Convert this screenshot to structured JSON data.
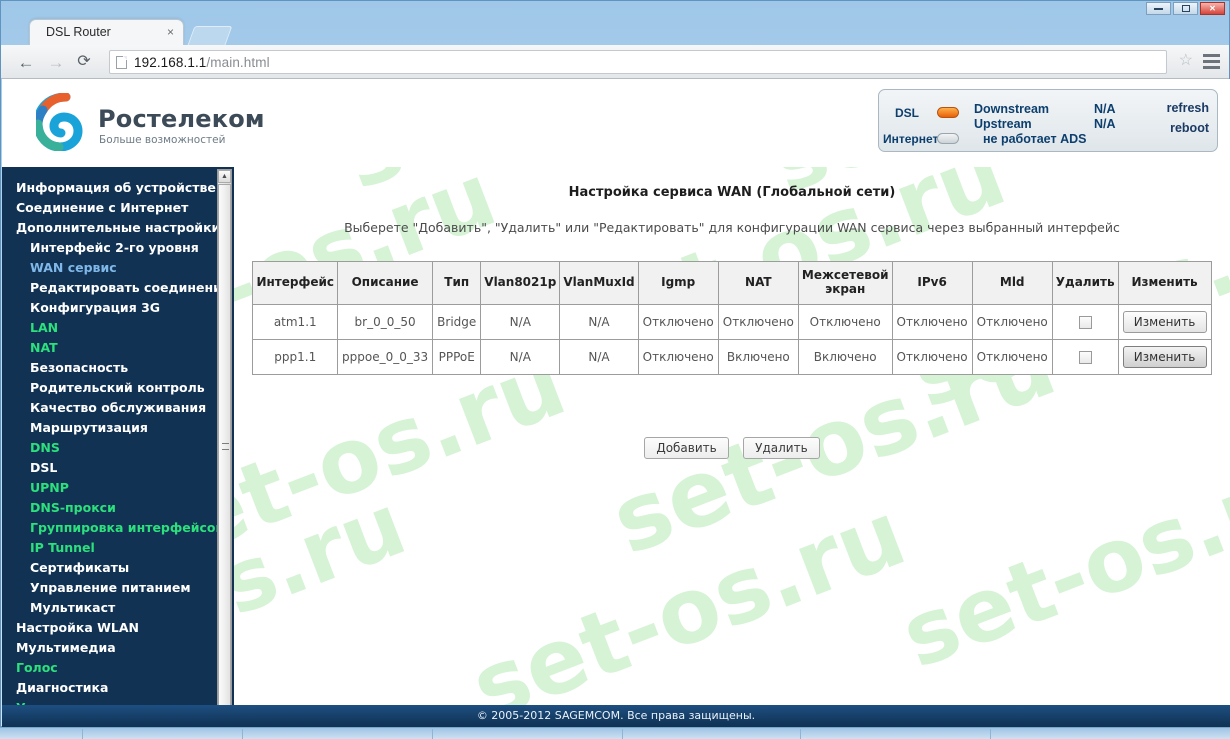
{
  "browser": {
    "tab_title": "DSL Router",
    "tab_close": "×",
    "back_icon": "←",
    "forward_icon": "→",
    "reload_icon": "⟳",
    "url_host": "192.168.1.1",
    "url_path": "/main.html",
    "star_icon": "☆",
    "window_close": "✕"
  },
  "header": {
    "brand_name": "Ростелеком",
    "brand_tagline": "Больше возможностей",
    "status": {
      "dsl_label": "DSL",
      "internet_label": "Интернет",
      "downstream_label": "Downstream",
      "downstream_value": "N/A",
      "upstream_label": "Upstream",
      "upstream_value": "N/A",
      "internet_message": "не работает ADS",
      "refresh_label": "refresh",
      "reboot_label": "reboot",
      "dsl_led_color": "#e8600c",
      "internet_led_color": "#ccd3d7"
    }
  },
  "sidebar": {
    "items": [
      {
        "label": "Информация об устройстве",
        "level": 1,
        "state": "normal"
      },
      {
        "label": "Соединение с Интернет",
        "level": 1,
        "state": "normal"
      },
      {
        "label": "Дополнительные настройки",
        "level": 1,
        "state": "normal"
      },
      {
        "label": "Интерфейс 2-го уровня",
        "level": 2,
        "state": "normal"
      },
      {
        "label": "WAN сервис",
        "level": 2,
        "state": "selected"
      },
      {
        "label": "Редактировать соединения",
        "level": 2,
        "state": "normal"
      },
      {
        "label": "Конфигурация 3G",
        "level": 2,
        "state": "normal"
      },
      {
        "label": "LAN",
        "level": 2,
        "state": "accent"
      },
      {
        "label": "NAT",
        "level": 2,
        "state": "accent"
      },
      {
        "label": "Безопасность",
        "level": 2,
        "state": "normal"
      },
      {
        "label": "Родительский контроль",
        "level": 2,
        "state": "normal"
      },
      {
        "label": "Качество обслуживания",
        "level": 2,
        "state": "normal"
      },
      {
        "label": "Маршрутизация",
        "level": 2,
        "state": "normal"
      },
      {
        "label": "DNS",
        "level": 2,
        "state": "accent"
      },
      {
        "label": "DSL",
        "level": 2,
        "state": "normal"
      },
      {
        "label": "UPNP",
        "level": 2,
        "state": "accent"
      },
      {
        "label": "DNS-прокси",
        "level": 2,
        "state": "accent"
      },
      {
        "label": "Группировка интерфейсов",
        "level": 2,
        "state": "accent"
      },
      {
        "label": "IP Tunnel",
        "level": 2,
        "state": "accent"
      },
      {
        "label": "Сертификаты",
        "level": 2,
        "state": "normal"
      },
      {
        "label": "Управление питанием",
        "level": 2,
        "state": "normal"
      },
      {
        "label": "Мультикаст",
        "level": 2,
        "state": "normal"
      },
      {
        "label": "Настройка WLAN",
        "level": 1,
        "state": "normal"
      },
      {
        "label": "Мультимедиа",
        "level": 1,
        "state": "normal"
      },
      {
        "label": "Голос",
        "level": 1,
        "state": "accent"
      },
      {
        "label": "Диагностика",
        "level": 1,
        "state": "normal"
      },
      {
        "label": "Управление",
        "level": 1,
        "state": "accent"
      }
    ]
  },
  "main": {
    "title": "Настройка сервиса WAN (Глобальной сети)",
    "subtitle": "Выберете \"Добавить\", \"Удалить\" или \"Редактировать\" для конфигурации WAN сервиса через выбранный интерфейс",
    "table": {
      "columns": [
        "Интерфейс",
        "Описание",
        "Тип",
        "Vlan8021p",
        "VlanMuxId",
        "Igmp",
        "NAT",
        "Межсетевой экран",
        "IPv6",
        "Mld",
        "Удалить",
        "Изменить"
      ],
      "rows": [
        {
          "interface": "atm1.1",
          "description": "br_0_0_50",
          "type": "Bridge",
          "vlan8021p": "N/A",
          "vlanmuxid": "N/A",
          "igmp": "Отключено",
          "nat": "Отключено",
          "firewall": "Отключено",
          "ipv6": "Отключено",
          "mld": "Отключено",
          "remove_checked": false,
          "edit_label": "Изменить",
          "edit_state": "normal"
        },
        {
          "interface": "ppp1.1",
          "description": "pppoe_0_0_33",
          "type": "PPPoE",
          "vlan8021p": "N/A",
          "vlanmuxid": "N/A",
          "igmp": "Отключено",
          "nat": "Включено",
          "firewall": "Включено",
          "ipv6": "Отключено",
          "mld": "Отключено",
          "remove_checked": false,
          "edit_label": "Изменить",
          "edit_state": "hover"
        }
      ]
    },
    "actions": {
      "add_label": "Добавить",
      "remove_label": "Удалить"
    }
  },
  "footer": {
    "copyright": "© 2005-2012 SAGEMCOM. Все права защищены."
  },
  "watermark": {
    "text": "set-os.ru",
    "color": "#d6f3d6"
  }
}
